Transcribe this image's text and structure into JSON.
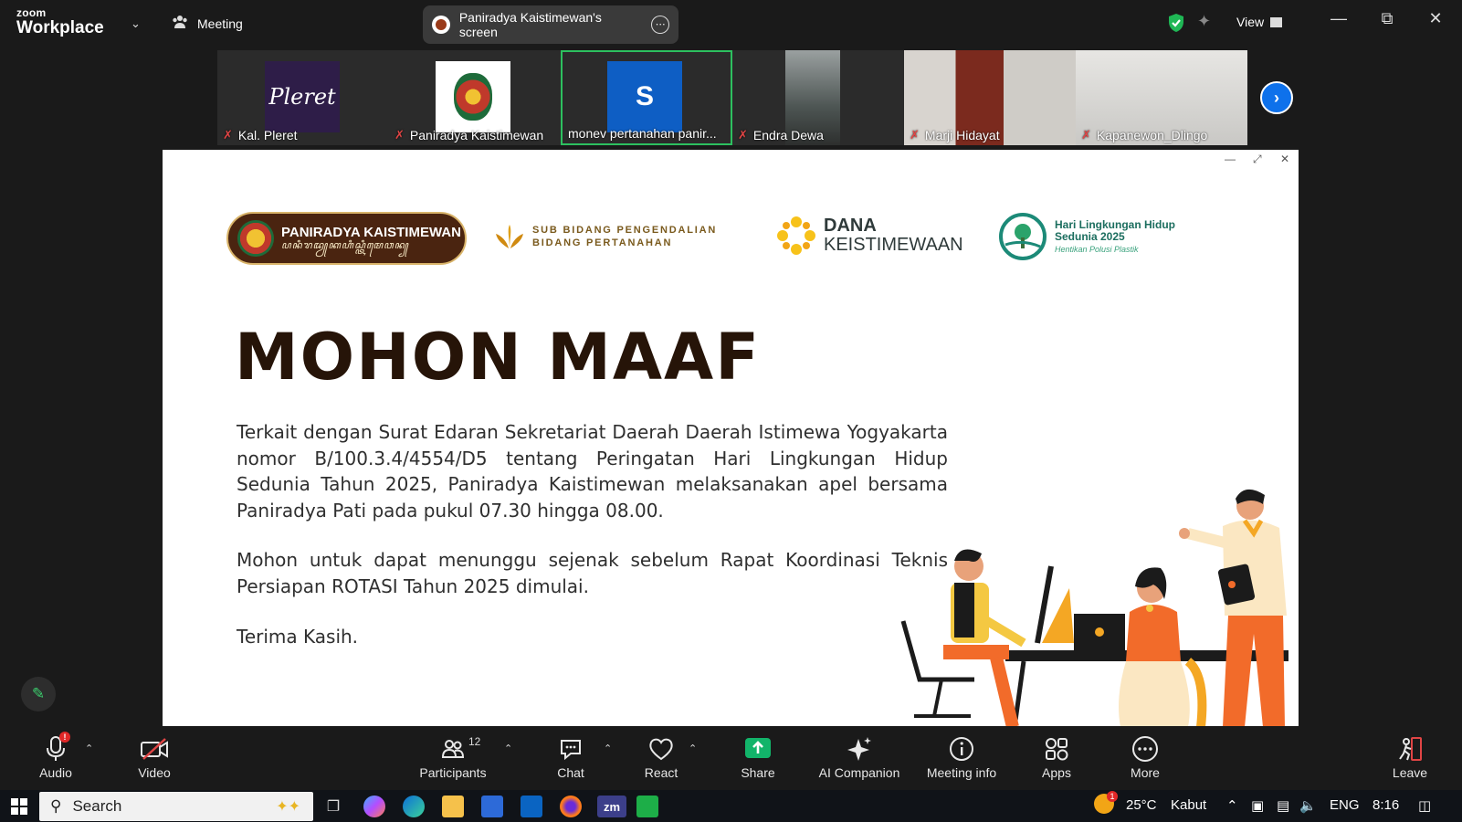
{
  "titlebar": {
    "brand_top": "zoom",
    "brand_bottom": "Workplace",
    "meeting_label": "Meeting",
    "screen_share_label": "Paniradya Kaistimewan's screen",
    "view_label": "View"
  },
  "participants_strip": [
    {
      "name": "Kal. Pleret",
      "muted": true
    },
    {
      "name": "Paniradya Kaistimewan",
      "muted": true
    },
    {
      "name": "monev pertanahan panir...",
      "muted": false,
      "initial": "S",
      "active": true
    },
    {
      "name": "Endra Dewa",
      "muted": true
    },
    {
      "name": "Marji Hidayat",
      "muted": true
    },
    {
      "name": "Kapanewon_Dlingo",
      "muted": true
    }
  ],
  "thumb_logo_text": "Pleret",
  "shared_screen": {
    "logos": {
      "paniradya_title": "PANIRADYA KAISTIMEWAN",
      "paniradya_script": "ꦥꦤꦶꦫꦢꦾꦏꦲꦶꦱ꧀ꦠꦶꦩꦺꦮꦤ꧀",
      "sub_bidang_line1": "SUB BIDANG PENGENDALIAN",
      "sub_bidang_line2": "BIDANG PERTANAHAN",
      "dana_line1": "DANA",
      "dana_line2": "KEISTIMEWAAN",
      "hari_line1": "Hari Lingkungan Hidup",
      "hari_line2": "Sedunia 2025",
      "hari_line3": "Hentikan Polusi Plastik"
    },
    "headline": "MOHON MAAF",
    "paragraph1": "Terkait dengan Surat Edaran Sekretariat Daerah Daerah Istimewa Yogyakarta nomor B/100.3.4/4554/D5 tentang Peringatan Hari Lingkungan Hidup Sedunia Tahun 2025, Paniradya Kaistimewan melaksanakan apel bersama Paniradya Pati pada pukul 07.30 hingga 08.00.",
    "paragraph2": "Mohon untuk dapat menunggu sejenak sebelum Rapat Koordinasi Teknis Persiapan ROTASI Tahun 2025 dimulai.",
    "paragraph3": "Terima Kasih."
  },
  "toolbar": {
    "audio": "Audio",
    "video": "Video",
    "participants": "Participants",
    "participants_count": "12",
    "chat": "Chat",
    "react": "React",
    "share": "Share",
    "ai_companion": "AI Companion",
    "meeting_info": "Meeting info",
    "apps": "Apps",
    "more": "More",
    "leave": "Leave",
    "audio_badge": "!"
  },
  "taskbar": {
    "search_placeholder": "Search",
    "weather": "25°C",
    "weather_desc": "Kabut",
    "language": "ENG",
    "time": "8:16",
    "weather_badge": "1",
    "zoom_app_label": "zm"
  },
  "colors": {
    "accent_green": "#2dc05f",
    "zoom_blue": "#0e71eb",
    "share_green": "#12b46a",
    "mute_red": "#e04545",
    "headline_dark": "#261408"
  }
}
